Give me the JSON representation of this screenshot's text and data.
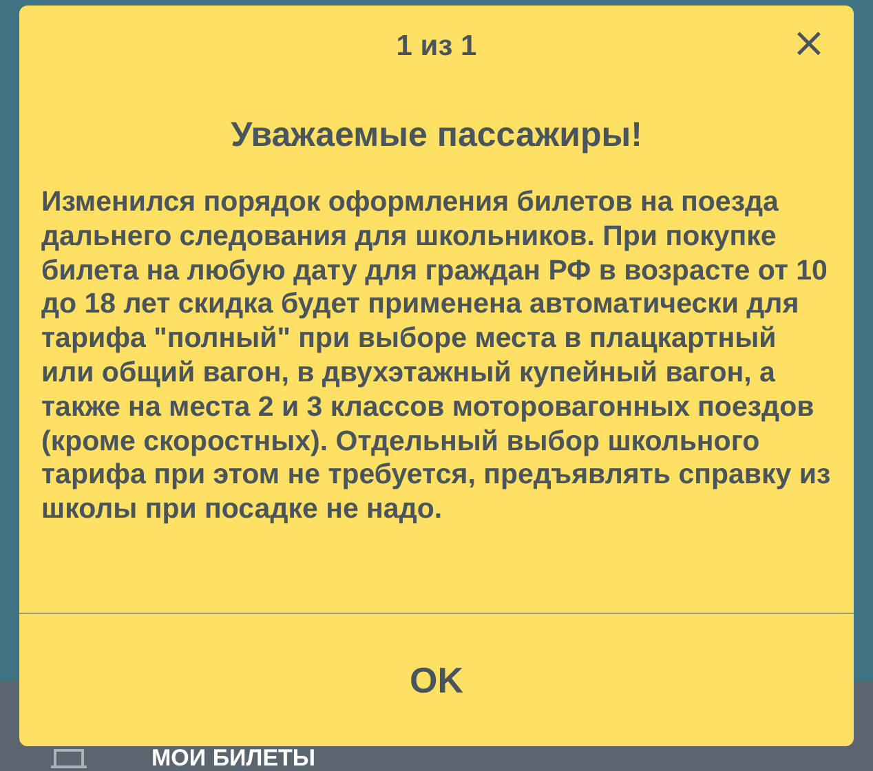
{
  "dialog": {
    "counter": "1 из 1",
    "close": "×",
    "title": "Уважаемые пассажиры!",
    "message": "Изменился порядок оформления билетов на поезда дальнего следования для школьников. При покупке билета на любую дату для граждан РФ в возрасте от 10 до 18 лет скидка будет применена автоматически для тарифа \"полный\" при выборе места в плацкартный или общий вагон, в двухэтажный купейный вагон, а также на места 2 и 3 классов моторовагонных поездов (кроме скоростных). Отдельный выбор школьного тарифа при этом не требуется, предъявлять справку из школы при посадке не надо.",
    "button": "OK"
  },
  "menu_item": {
    "label": "МОИ БИЛЕТЫ"
  }
}
